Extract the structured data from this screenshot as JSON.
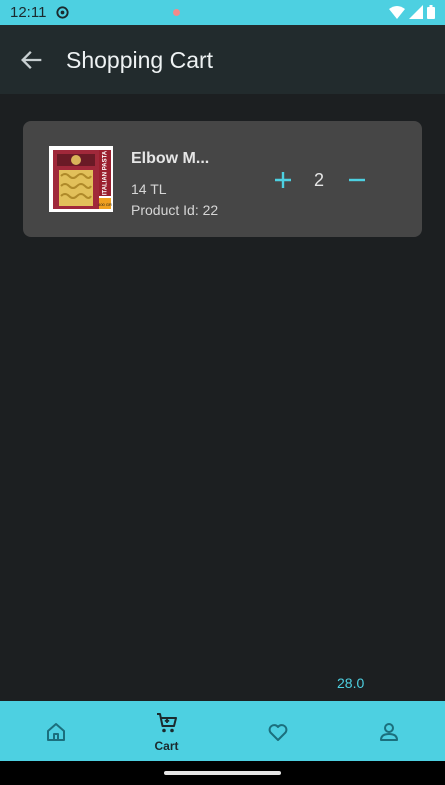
{
  "status_bar": {
    "time": "12:11",
    "icons": [
      "settings-gear-icon",
      "wifi-icon",
      "signal-icon",
      "battery-icon"
    ]
  },
  "app_bar": {
    "title": "Shopping Cart",
    "back_icon": "arrow-left-icon"
  },
  "cart": {
    "items": [
      {
        "name": "Elbow M...",
        "price": "14 TL",
        "product_id": "Product Id: 22",
        "quantity": "2",
        "image": {
          "brand_text": "ITALIAN PASTA",
          "weight_text": "400 GR"
        }
      }
    ],
    "total": "28.0"
  },
  "bottom_nav": {
    "items": [
      {
        "icon": "home-icon",
        "label": ""
      },
      {
        "icon": "cart-icon",
        "label": "Cart",
        "selected": true
      },
      {
        "icon": "heart-icon",
        "label": ""
      },
      {
        "icon": "person-icon",
        "label": ""
      }
    ]
  },
  "colors": {
    "accent": "#4dd0e1",
    "background": "#1c1f21",
    "app_bar": "#222b2d",
    "card": "#464646",
    "badge": "#f48a8a"
  }
}
